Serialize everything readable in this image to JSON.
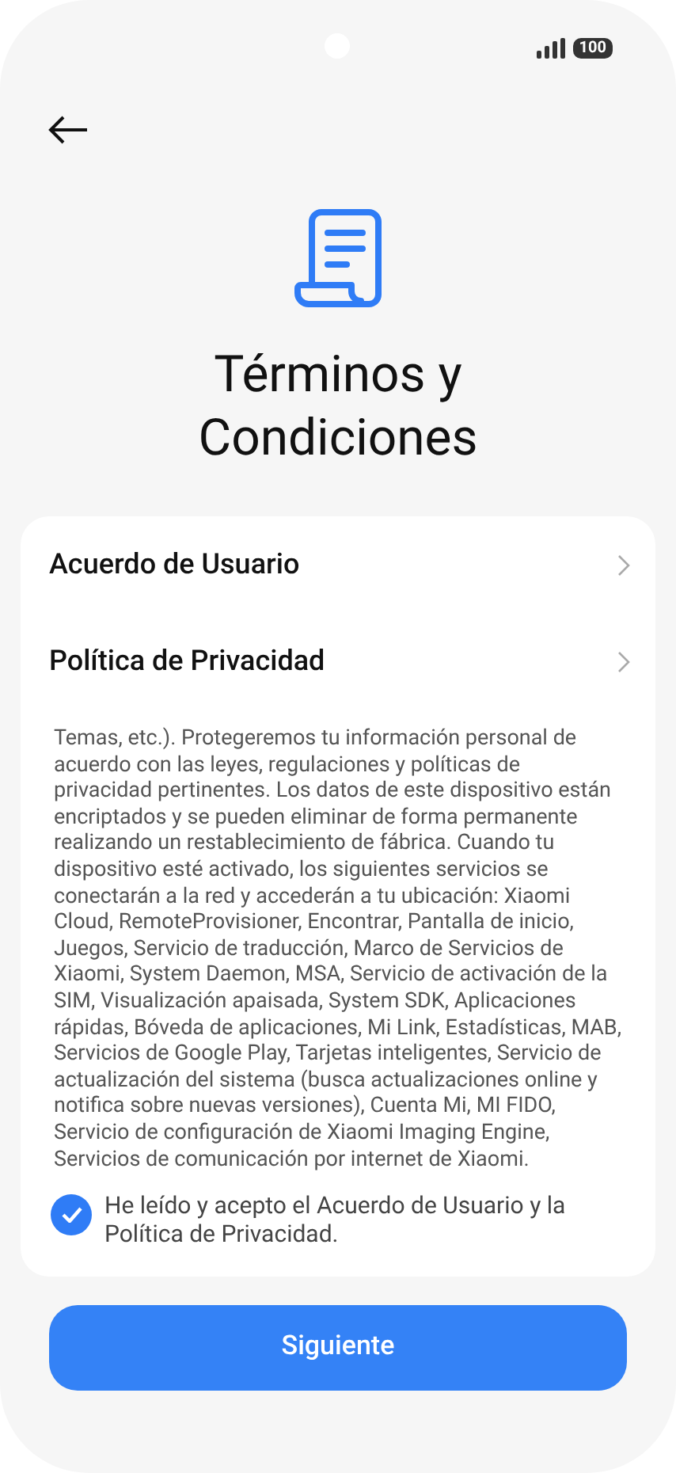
{
  "status_bar": {
    "battery": "100"
  },
  "title": "Términos y Condiciones",
  "links": [
    {
      "label": "Acuerdo de Usuario"
    },
    {
      "label": "Política de Privacidad"
    }
  ],
  "terms_text": "Temas, etc.). Protegeremos tu información personal de acuerdo con las leyes, regulaciones y políticas de privacidad pertinentes. Los datos de este dispositivo están encriptados y se pueden eliminar de forma permanente realizando un restablecimiento de fábrica. Cuando tu dispositivo esté activado, los siguientes servicios se conectarán a la red y accederán a tu ubicación: Xiaomi Cloud, RemoteProvisioner, Encontrar, Pantalla de inicio, Juegos, Servicio de traducción, Marco de Servicios de Xiaomi, System Daemon, MSA, Servicio de activación de la SIM, Visualización apaisada, System SDK, Aplicaciones rápidas, Bóveda de aplicaciones, Mi Link, Estadísticas, MAB, Servicios de Google Play, Tarjetas inteligentes, Servicio de actualización del sistema (busca actualizaciones online y notifica sobre nuevas versiones), Cuenta Mi, MI FIDO, Servicio de configuración de Xiaomi Imaging Engine, Servicios de comunicación por internet de Xiaomi.",
  "agreement": {
    "label": "He leído y acepto el Acuerdo de Usuario y la Política de Privacidad.",
    "checked": true
  },
  "next_button": "Siguiente"
}
